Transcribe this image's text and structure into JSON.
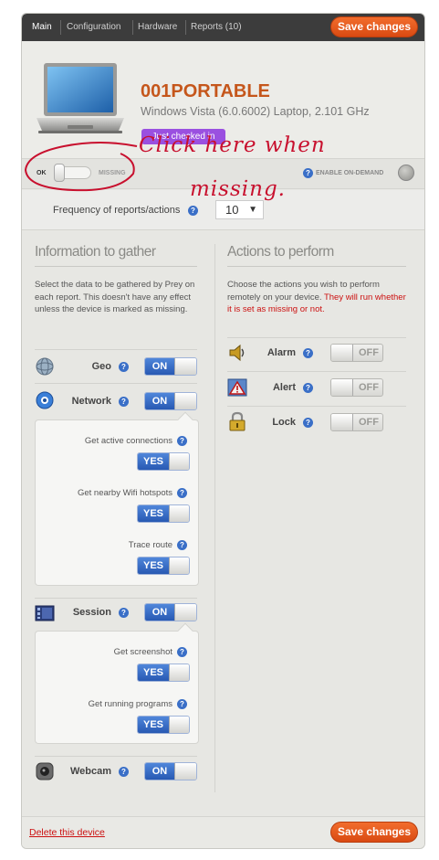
{
  "nav": {
    "tabs": [
      {
        "label": "Main"
      },
      {
        "label": "Configuration"
      },
      {
        "label": "Hardware"
      },
      {
        "label": "Reports (10)"
      }
    ],
    "save_label": "Save changes"
  },
  "device": {
    "name": "001PORTABLE",
    "description": "Windows Vista (6.0.6002) Laptop, 2.101 GHz",
    "badge": "Just checked in"
  },
  "status": {
    "ok_label": "OK",
    "missing_label": "MISSING",
    "enable_label": "ENABLE ON-DEMAND"
  },
  "frequency": {
    "label": "Frequency of reports/actions",
    "value": "10"
  },
  "info": {
    "title": "Information to gather",
    "description": "Select the data to be gathered by Prey on each report. This doesn't have any effect unless the device is marked as missing.",
    "modules": [
      {
        "label": "Geo",
        "state": "ON"
      },
      {
        "label": "Network",
        "state": "ON",
        "options": [
          {
            "label": "Get active connections",
            "state": "YES"
          },
          {
            "label": "Get nearby Wifi hotspots",
            "state": "YES"
          },
          {
            "label": "Trace route",
            "state": "YES"
          }
        ]
      },
      {
        "label": "Session",
        "state": "ON",
        "options": [
          {
            "label": "Get screenshot",
            "state": "YES"
          },
          {
            "label": "Get running programs",
            "state": "YES"
          }
        ]
      },
      {
        "label": "Webcam",
        "state": "ON"
      }
    ]
  },
  "actions": {
    "title": "Actions to perform",
    "description": "Choose the actions you wish to perform remotely on your device.",
    "warning": "They will run whether it is set as missing or not.",
    "items": [
      {
        "label": "Alarm",
        "state": "OFF"
      },
      {
        "label": "Alert",
        "state": "OFF"
      },
      {
        "label": "Lock",
        "state": "OFF"
      }
    ]
  },
  "footer": {
    "delete_label": "Delete this device",
    "save_label": "Save changes"
  },
  "annotation": {
    "line1": "Click here when",
    "line2": "missing."
  },
  "colors": {
    "accent": "#e0561a",
    "switch_on": "#2f63c0",
    "badge": "#9a50e0",
    "annotation": "#c8102e"
  }
}
